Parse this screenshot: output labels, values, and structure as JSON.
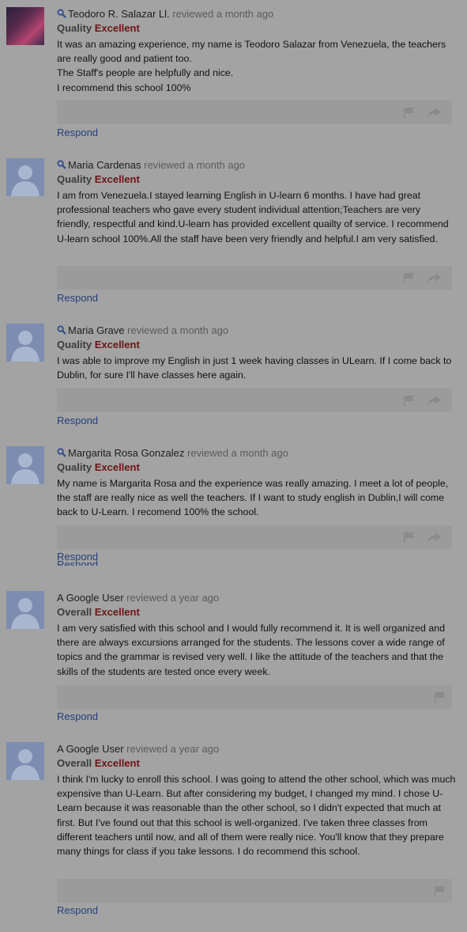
{
  "reviews": [
    {
      "author": "Teodoro R. Salazar Ll.",
      "meta": "reviewed a month ago",
      "aspect": "Quality",
      "level": "Excellent",
      "lines": [
        "It was an amazing experience, my name is Teodoro Salazar from Venezuela, the teachers are really good and patient too.",
        "The Staff's people are helpfully and nice.",
        "I recommend this school 100%"
      ],
      "respond": "Respond"
    },
    {
      "author": "Maria Cardenas",
      "meta": "reviewed a month ago",
      "aspect": "Quality",
      "level": "Excellent",
      "lines": [
        "I am from Venezuela.I stayed learning English in U-learn 6 months. I have had great professional teachers who gave every student individual attention;Teachers are very friendly, respectful and kind.U-learn has provided excellent quailty of service. I recommend U-learn school 100%.All the staff have been very friendly and helpful.I am very satisfied."
      ],
      "respond": "Respond"
    },
    {
      "author": "Maria Grave",
      "meta": "reviewed a month ago",
      "aspect": "Quality",
      "level": "Excellent",
      "lines": [
        "I was able to improve my English in just 1 week having classes in ULearn. If I come back to Dublin, for sure I'll have classes here again."
      ],
      "respond": "Respond"
    },
    {
      "author": "Margarita Rosa Gonzalez",
      "meta": "reviewed a month ago",
      "aspect": "Quality",
      "level": "Excellent",
      "lines": [
        "My name is Margarita Rosa and the experience was really amazing. I meet a lot of people, the staff are really nice as well the teachers. If I want to study english in Dublin,I will come back to U-Learn. I recomend 100% the school."
      ],
      "respond": "Respond"
    },
    {
      "author": "A Google User",
      "meta": "reviewed a year ago",
      "aspect": "Overall",
      "level": "Excellent",
      "lines": [
        "I am very satisfied with this school and I would fully recommend it. It is well organized and there are always excursions arranged for the students. The lessons cover a wide range of topics and the grammar is revised very well. I like the attitude of the teachers and that the skills of the students are tested once every week."
      ],
      "respond": "Respond"
    },
    {
      "author": "A Google User",
      "meta": "reviewed a year ago",
      "aspect": "Overall",
      "level": "Excellent",
      "lines": [
        "I think I'm lucky to enroll this school. I was going to attend the other school, which was much expensive than U-Learn. But after considering my budget, I changed my mind. I chose U-Learn because it was reasonable than the other school, so I didn't expected that much at first. But I've found out that this school is well-organized. I've taken three classes from different teachers until now, and all of them were really nice. You'll know that they prepare many things for class if you take lessons. I do recommend this school."
      ],
      "respond": "Respond"
    }
  ],
  "ghost_respond": "Respond",
  "icons": {
    "search": "search-icon",
    "flag": "flag-icon",
    "share": "share-arrow-icon",
    "avatar": "default-avatar-icon"
  },
  "colors": {
    "background": "#a3a3a3",
    "link": "#25407a",
    "rating_level": "#6a1616",
    "action_bar": "#9b9b9b"
  }
}
